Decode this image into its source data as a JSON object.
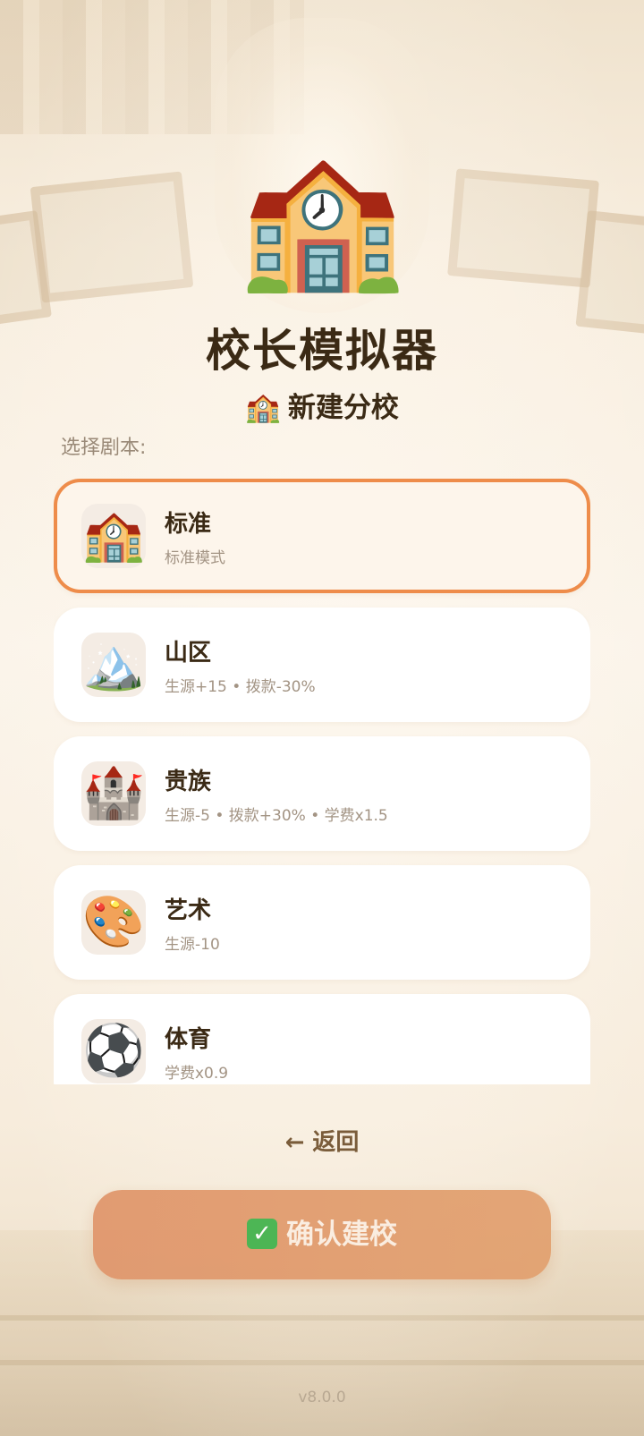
{
  "app": {
    "hero_icon": "🏫",
    "title": "校长模拟器",
    "subtitle_icon": "🏫",
    "subtitle": "新建分校",
    "section_label": "选择剧本:"
  },
  "scenarios": [
    {
      "icon": "🏫",
      "icon_name": "school-icon",
      "title": "标准",
      "desc": "标准模式",
      "selected": true
    },
    {
      "icon": "🏔️",
      "icon_name": "mountain-icon",
      "title": "山区",
      "desc": "生源+15 • 拨款-30%",
      "selected": false
    },
    {
      "icon": "🏰",
      "icon_name": "castle-icon",
      "title": "贵族",
      "desc": "生源-5 • 拨款+30% • 学费x1.5",
      "selected": false
    },
    {
      "icon": "🎨",
      "icon_name": "palette-icon",
      "title": "艺术",
      "desc": "生源-10",
      "selected": false
    },
    {
      "icon": "⚽",
      "icon_name": "soccer-ball-icon",
      "title": "体育",
      "desc": "学费x0.9",
      "selected": false
    }
  ],
  "actions": {
    "back_label": "← 返回",
    "confirm_icon": "✓",
    "confirm_label": "确认建校"
  },
  "footer": {
    "version": "v8.0.0"
  },
  "colors": {
    "title": "#3b2a15",
    "selected_border": "#ee8c4a",
    "confirm_button": "#e0956a",
    "muted_text": "#a39484"
  }
}
